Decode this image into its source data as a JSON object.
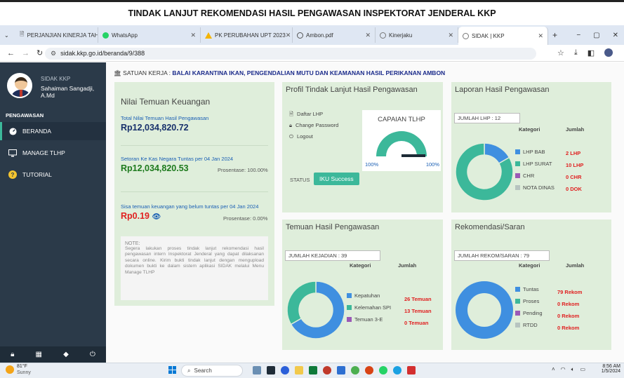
{
  "banner": {
    "title": "TINDAK LANJUT REKOMENDASI HASIL PENGAWASAN INSPEKTORAT JENDERAL KKP"
  },
  "tabs": [
    {
      "label": "PERJANJIAN KINERJA TAH",
      "color": "#7a8899"
    },
    {
      "label": "WhatsApp",
      "color": "#25d366"
    },
    {
      "label": "PK PERUBAHAN UPT 2023",
      "color": "#f4b400"
    },
    {
      "label": "Ambon.pdf",
      "color": "#555"
    },
    {
      "label": "Kinerjaku",
      "color": "#777"
    },
    {
      "label": "SIDAK | KKP",
      "color": "#777"
    }
  ],
  "address": {
    "url": "sidak.kkp.go.id/beranda/9/388"
  },
  "sidebar": {
    "app_name": "SIDAK KKP",
    "user_name": "Sahaiman Sangadji,",
    "user_title": "A.Md",
    "section": "PENGAWASAN",
    "items": [
      {
        "label": "BERANDA",
        "icon": "gauge-icon"
      },
      {
        "label": "MANAGE TLHP",
        "icon": "monitor-icon"
      },
      {
        "label": "TUTORIAL",
        "icon": "question-icon"
      }
    ]
  },
  "satker": {
    "label": "SATUAN KERJA :",
    "value": "BALAI KARANTINA IKAN, PENGENDALIAN MUTU DAN KEAMANAN HASIL PERIKANAN AMBON"
  },
  "keuangan": {
    "title": "Nilai Temuan Keuangan",
    "total_label": "Total Nilai Temuan Hasil Pengawasan",
    "total_value": "Rp12,034,820.72",
    "setoran_label": "Setoran Ke Kas Negara Tuntas per 04 Jan 2024",
    "setoran_value": "Rp12,034,820.53",
    "setoran_pct": "Prosentase: 100.00%",
    "sisa_label": "Sisa temuan keuangan yang belum tuntas per 04 Jan 2024",
    "sisa_value": "Rp0.19",
    "sisa_pct": "Prosentase: 0.00%",
    "note_title": "NOTE:",
    "note_text": "Segera lakukan proses tindak lanjut rekomendasi hasil pengawasan intern Inspektorat Jenderal yang dapat dilaksanan secara online. Kirim bukti tindak lanjut dengan mengupload dokumen bukti ke dalam sistem aplikasi SIDAK melalui Menu Manage TLHP"
  },
  "profil": {
    "title": "Profil Tindak Lanjut Hasil Pengawasan",
    "links": [
      "Daftar LHP",
      "Change Password",
      "Logout"
    ],
    "status_label": "STATUS",
    "status_button": "IKU Success",
    "capaian_title": "CAPAIAN TLHP",
    "capaian_left": "100%",
    "capaian_right": "100%",
    "capaian_level": 1.0
  },
  "laporan": {
    "title": "Laporan Hasil Pengawasan",
    "box": "JUMLAH LHP : 12",
    "head_kat": "Kategori",
    "head_jml": "Jumlah",
    "items": [
      {
        "label": "LHP BAB",
        "value": "2 LHP",
        "n": 2,
        "color": "#3f8fe0"
      },
      {
        "label": "LHP SURAT",
        "value": "10 LHP",
        "n": 10,
        "color": "#3cb89a"
      },
      {
        "label": "CHR",
        "value": "0 CHR",
        "n": 0,
        "color": "#9b59b6"
      },
      {
        "label": "NOTA DINAS",
        "value": "0 DOK",
        "n": 0,
        "color": "#b7c4c0"
      }
    ]
  },
  "temuan": {
    "title": "Temuan Hasil Pengawasan",
    "box": "JUMLAH KEJADIAN : 39",
    "head_kat": "Kategori",
    "head_jml": "Jumlah",
    "items": [
      {
        "label": "Kepatuhan",
        "value": "26 Temuan",
        "n": 26,
        "color": "#3f8fe0"
      },
      {
        "label": "Kelemahan SPI",
        "value": "13 Temuan",
        "n": 13,
        "color": "#3cb89a"
      },
      {
        "label": "Temuan 3-E",
        "value": "0 Temuan",
        "n": 0,
        "color": "#9b59b6"
      }
    ]
  },
  "rekom": {
    "title": "Rekomendasi/Saran",
    "box": "JUMLAH REKOM/SARAN : 79",
    "head_kat": "Kategori",
    "head_jml": "Jumlah",
    "items": [
      {
        "label": "Tuntas",
        "value": "79 Rekom",
        "n": 79,
        "color": "#3f8fe0"
      },
      {
        "label": "Proses",
        "value": "0 Rekom",
        "n": 0,
        "color": "#3cb89a"
      },
      {
        "label": "Pending",
        "value": "0 Rekom",
        "n": 0,
        "color": "#9b59b6"
      },
      {
        "label": "RTDD",
        "value": "0 Rekom",
        "n": 0,
        "color": "#b7c4c0"
      }
    ]
  },
  "taskbar": {
    "weather_temp": "81°F",
    "weather_desc": "Sunny",
    "search": "Search",
    "time": "8:56 AM",
    "date": "1/5/2024"
  }
}
